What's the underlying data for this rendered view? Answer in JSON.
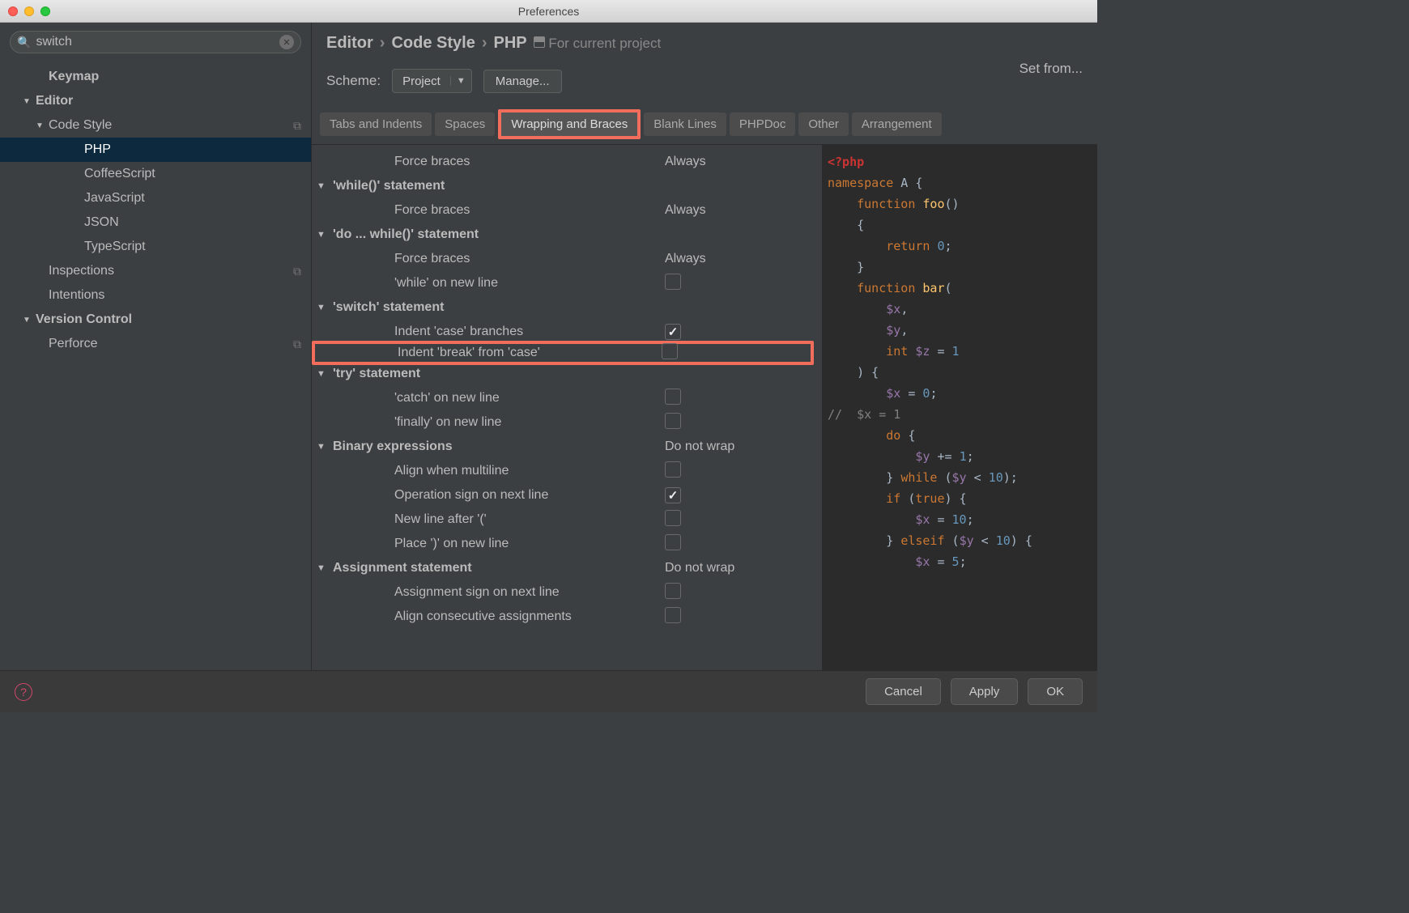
{
  "window": {
    "title": "Preferences"
  },
  "search": {
    "value": "switch"
  },
  "sidebar": {
    "items": [
      {
        "label": "Keymap",
        "indent": 1,
        "bold": true
      },
      {
        "label": "Editor",
        "indent": 0,
        "bold": true,
        "expanded": true
      },
      {
        "label": "Code Style",
        "indent": 1,
        "expanded": true,
        "copy": true
      },
      {
        "label": "PHP",
        "indent": 3,
        "selected": true
      },
      {
        "label": "CoffeeScript",
        "indent": 3
      },
      {
        "label": "JavaScript",
        "indent": 3
      },
      {
        "label": "JSON",
        "indent": 3
      },
      {
        "label": "TypeScript",
        "indent": 3
      },
      {
        "label": "Inspections",
        "indent": 1,
        "copy": true
      },
      {
        "label": "Intentions",
        "indent": 1
      },
      {
        "label": "Version Control",
        "indent": 0,
        "bold": true,
        "expanded": true
      },
      {
        "label": "Perforce",
        "indent": 1,
        "copy": true
      }
    ]
  },
  "breadcrumb": {
    "parts": [
      "Editor",
      "Code Style",
      "PHP"
    ],
    "scope": "For current project"
  },
  "scheme": {
    "label": "Scheme:",
    "value": "Project",
    "manage": "Manage..."
  },
  "set_from": "Set from...",
  "tabs": [
    "Tabs and Indents",
    "Spaces",
    "Wrapping and Braces",
    "Blank Lines",
    "PHPDoc",
    "Other",
    "Arrangement"
  ],
  "active_tab": 2,
  "highlighted_tab": 2,
  "options": [
    {
      "label": "Force braces",
      "indent": 1,
      "value_text": "Always"
    },
    {
      "label": "'while()' statement",
      "indent": 0,
      "header": true
    },
    {
      "label": "Force braces",
      "indent": 1,
      "value_text": "Always"
    },
    {
      "label": "'do ... while()' statement",
      "indent": 0,
      "header": true
    },
    {
      "label": "Force braces",
      "indent": 1,
      "value_text": "Always"
    },
    {
      "label": "'while' on new line",
      "indent": 1,
      "checkbox": true,
      "checked": false
    },
    {
      "label": "'switch' statement",
      "indent": 0,
      "header": true
    },
    {
      "label": "Indent 'case' branches",
      "indent": 1,
      "checkbox": true,
      "checked": true
    },
    {
      "label": "Indent 'break' from 'case'",
      "indent": 1,
      "checkbox": true,
      "checked": false,
      "highlight": true
    },
    {
      "label": "'try' statement",
      "indent": 0,
      "header": true
    },
    {
      "label": "'catch' on new line",
      "indent": 1,
      "checkbox": true,
      "checked": false
    },
    {
      "label": "'finally' on new line",
      "indent": 1,
      "checkbox": true,
      "checked": false
    },
    {
      "label": "Binary expressions",
      "indent": 0,
      "header": true,
      "value_text": "Do not wrap"
    },
    {
      "label": "Align when multiline",
      "indent": 1,
      "checkbox": true,
      "checked": false
    },
    {
      "label": "Operation sign on next line",
      "indent": 1,
      "checkbox": true,
      "checked": true
    },
    {
      "label": "New line after '('",
      "indent": 1,
      "checkbox": true,
      "checked": false
    },
    {
      "label": "Place ')' on new line",
      "indent": 1,
      "checkbox": true,
      "checked": false
    },
    {
      "label": "Assignment statement",
      "indent": 0,
      "header": true,
      "value_text": "Do not wrap"
    },
    {
      "label": "Assignment sign on next line",
      "indent": 1,
      "checkbox": true,
      "checked": false
    },
    {
      "label": "Align consecutive assignments",
      "indent": 1,
      "checkbox": true,
      "checked": false
    }
  ],
  "code_tokens": [
    [
      [
        "pi",
        "<?php"
      ]
    ],
    [
      [
        "kw",
        "namespace"
      ],
      [
        "plain",
        " A {"
      ]
    ],
    [
      [
        "plain",
        ""
      ]
    ],
    [
      [
        "plain",
        "    "
      ],
      [
        "kw",
        "function"
      ],
      [
        "plain",
        " "
      ],
      [
        "fn",
        "foo"
      ],
      [
        "plain",
        "()"
      ]
    ],
    [
      [
        "plain",
        "    {"
      ]
    ],
    [
      [
        "plain",
        "        "
      ],
      [
        "kw",
        "return"
      ],
      [
        "plain",
        " "
      ],
      [
        "num",
        "0"
      ],
      [
        "plain",
        ";"
      ]
    ],
    [
      [
        "plain",
        "    }"
      ]
    ],
    [
      [
        "plain",
        ""
      ]
    ],
    [
      [
        "plain",
        "    "
      ],
      [
        "kw",
        "function"
      ],
      [
        "plain",
        " "
      ],
      [
        "fn",
        "bar"
      ],
      [
        "plain",
        "("
      ]
    ],
    [
      [
        "plain",
        "        "
      ],
      [
        "var",
        "$x"
      ],
      [
        "plain",
        ","
      ]
    ],
    [
      [
        "plain",
        "        "
      ],
      [
        "var",
        "$y"
      ],
      [
        "plain",
        ","
      ]
    ],
    [
      [
        "plain",
        "        "
      ],
      [
        "kw",
        "int"
      ],
      [
        "plain",
        " "
      ],
      [
        "var",
        "$z"
      ],
      [
        "plain",
        " = "
      ],
      [
        "num",
        "1"
      ]
    ],
    [
      [
        "plain",
        "    ) {"
      ]
    ],
    [
      [
        "plain",
        "        "
      ],
      [
        "var",
        "$x"
      ],
      [
        "plain",
        " = "
      ],
      [
        "num",
        "0"
      ],
      [
        "plain",
        ";"
      ]
    ],
    [
      [
        "comment",
        "//  $x = 1"
      ]
    ],
    [
      [
        "plain",
        "        "
      ],
      [
        "kw",
        "do"
      ],
      [
        "plain",
        " {"
      ]
    ],
    [
      [
        "plain",
        "            "
      ],
      [
        "var",
        "$y"
      ],
      [
        "plain",
        " "
      ],
      [
        "op",
        "+="
      ],
      [
        "plain",
        " "
      ],
      [
        "num",
        "1"
      ],
      [
        "plain",
        ";"
      ]
    ],
    [
      [
        "plain",
        "        } "
      ],
      [
        "kw",
        "while"
      ],
      [
        "plain",
        " ("
      ],
      [
        "var",
        "$y"
      ],
      [
        "plain",
        " "
      ],
      [
        "op",
        "<"
      ],
      [
        "plain",
        " "
      ],
      [
        "num",
        "10"
      ],
      [
        "plain",
        ");"
      ]
    ],
    [
      [
        "plain",
        "        "
      ],
      [
        "kw",
        "if"
      ],
      [
        "plain",
        " ("
      ],
      [
        "true",
        "true"
      ],
      [
        "plain",
        ") {"
      ]
    ],
    [
      [
        "plain",
        "            "
      ],
      [
        "var",
        "$x"
      ],
      [
        "plain",
        " = "
      ],
      [
        "num",
        "10"
      ],
      [
        "plain",
        ";"
      ]
    ],
    [
      [
        "plain",
        "        } "
      ],
      [
        "kw",
        "elseif"
      ],
      [
        "plain",
        " ("
      ],
      [
        "var",
        "$y"
      ],
      [
        "plain",
        " "
      ],
      [
        "op",
        "<"
      ],
      [
        "plain",
        " "
      ],
      [
        "num",
        "10"
      ],
      [
        "plain",
        ") {"
      ]
    ],
    [
      [
        "plain",
        "            "
      ],
      [
        "var",
        "$x"
      ],
      [
        "plain",
        " = "
      ],
      [
        "num",
        "5"
      ],
      [
        "plain",
        ";"
      ]
    ]
  ],
  "footer": {
    "cancel": "Cancel",
    "apply": "Apply",
    "ok": "OK"
  }
}
